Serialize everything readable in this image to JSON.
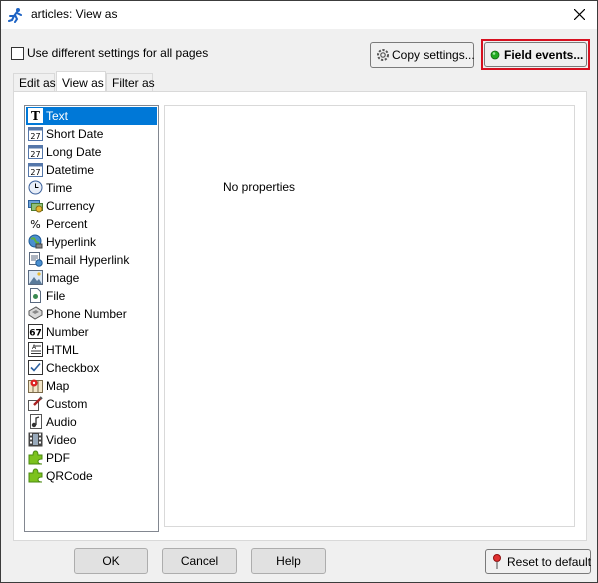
{
  "window": {
    "title": "articles: View as",
    "title_icon": "runner-icon"
  },
  "options": {
    "different_settings_label": "Use different settings for all pages",
    "different_settings_checked": false
  },
  "toolbar": {
    "copy_settings_label": "Copy settings...",
    "field_events_label": "Field events...",
    "field_events_status_color": "#22aa22"
  },
  "tabs": [
    {
      "label": "Edit as",
      "active": false
    },
    {
      "label": "View as",
      "active": true
    },
    {
      "label": "Filter as",
      "active": false
    }
  ],
  "formats": [
    {
      "label": "Text",
      "icon": "text-T-icon",
      "selected": true
    },
    {
      "label": "Short Date",
      "icon": "calendar-icon"
    },
    {
      "label": "Long Date",
      "icon": "calendar-icon"
    },
    {
      "label": "Datetime",
      "icon": "calendar-icon"
    },
    {
      "label": "Time",
      "icon": "clock-icon"
    },
    {
      "label": "Currency",
      "icon": "money-icon"
    },
    {
      "label": "Percent",
      "icon": "percent-icon"
    },
    {
      "label": "Hyperlink",
      "icon": "globe-icon"
    },
    {
      "label": "Email Hyperlink",
      "icon": "email-icon"
    },
    {
      "label": "Image",
      "icon": "image-icon"
    },
    {
      "label": "File",
      "icon": "file-icon"
    },
    {
      "label": "Phone Number",
      "icon": "phone-icon"
    },
    {
      "label": "Number",
      "icon": "number-icon"
    },
    {
      "label": "HTML",
      "icon": "html-icon"
    },
    {
      "label": "Checkbox",
      "icon": "checkbox-icon"
    },
    {
      "label": "Map",
      "icon": "map-icon"
    },
    {
      "label": "Custom",
      "icon": "custom-icon"
    },
    {
      "label": "Audio",
      "icon": "audio-icon"
    },
    {
      "label": "Video",
      "icon": "video-icon"
    },
    {
      "label": "PDF",
      "icon": "puzzle-icon"
    },
    {
      "label": "QRCode",
      "icon": "puzzle-icon"
    }
  ],
  "properties": {
    "empty_text": "No properties"
  },
  "footer": {
    "ok_label": "OK",
    "cancel_label": "Cancel",
    "help_label": "Help",
    "reset_label": "Reset to default"
  },
  "colors": {
    "selection": "#0078d7",
    "highlight_frame": "#d6101f",
    "puzzle_green": "#7cc21e"
  }
}
